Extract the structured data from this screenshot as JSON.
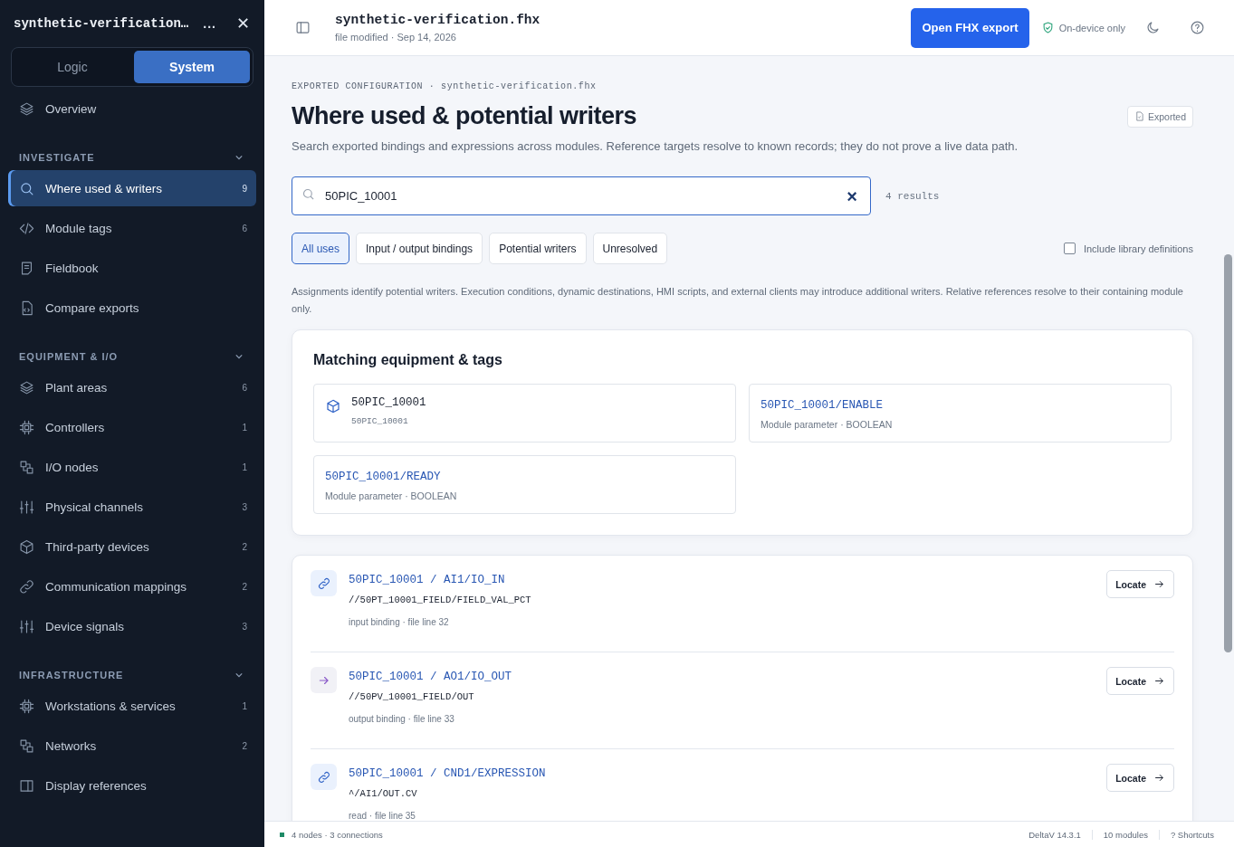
{
  "sidebar": {
    "file_title": "synthetic-verification…",
    "more": "...",
    "close": "✕",
    "modes": [
      {
        "label": "Logic",
        "selected": false
      },
      {
        "label": "System",
        "selected": true
      }
    ],
    "top_items": [
      {
        "label": "Overview",
        "selected": false
      }
    ],
    "sections": [
      {
        "title": "INVESTIGATE",
        "expanded": true,
        "items": [
          {
            "label": "Where used & writers",
            "count": "9",
            "selected": true
          },
          {
            "label": "Module tags",
            "count": "6",
            "selected": false
          },
          {
            "label": "Fieldbook",
            "selected": false
          },
          {
            "label": "Compare exports",
            "selected": false
          }
        ]
      },
      {
        "title": "EQUIPMENT & I/O",
        "expanded": true,
        "items": [
          {
            "label": "Plant areas",
            "count": "6",
            "selected": false
          },
          {
            "label": "Controllers",
            "count": "1",
            "selected": false
          },
          {
            "label": "I/O nodes",
            "count": "1",
            "selected": false
          },
          {
            "label": "Physical channels",
            "count": "3",
            "selected": false
          },
          {
            "label": "Third-party devices",
            "count": "2",
            "selected": false
          },
          {
            "label": "Communication mappings",
            "count": "2",
            "selected": false
          },
          {
            "label": "Device signals",
            "count": "3",
            "selected": false
          }
        ]
      },
      {
        "title": "INFRASTRUCTURE",
        "expanded": true,
        "items": [
          {
            "label": "Workstations & services",
            "count": "1",
            "selected": false
          },
          {
            "label": "Networks",
            "count": "2",
            "selected": false
          },
          {
            "label": "Display references",
            "selected": false
          }
        ]
      }
    ]
  },
  "header": {
    "title": "synthetic-verification.fhx",
    "subtitle": "file modified · Sep 14, 2026",
    "primary_button": "Open FHX export",
    "privacy": "On-device only"
  },
  "page": {
    "eyebrow": "EXPORTED CONFIGURATION · synthetic-verification.fhx",
    "title": "Where used & potential writers",
    "badge": "Exported",
    "description": "Search exported bindings and expressions across modules. Reference targets resolve to known records; they do not prove a live data path.",
    "search": {
      "value": "50PIC_10001",
      "clear": "×",
      "result_count": "4 results"
    },
    "filters": [
      {
        "label": "All uses",
        "selected": true
      },
      {
        "label": "Input / output bindings",
        "selected": false
      },
      {
        "label": "Potential writers",
        "selected": false
      },
      {
        "label": "Unresolved",
        "selected": false
      }
    ],
    "include_library": {
      "label": "Include library definitions",
      "checked": false
    },
    "notice": "Assignments identify potential writers. Execution conditions, dynamic destinations, HMI scripts, and external clients may introduce additional writers. Relative references resolve to their containing module only.",
    "matches": {
      "title": "Matching equipment & tags",
      "items": [
        {
          "kind": "module",
          "name": "50PIC_10001",
          "detail": "50PIC_10001"
        },
        {
          "kind": "parameter",
          "name": "50PIC_10001/ENABLE",
          "detail": "Module parameter · BOOLEAN"
        },
        {
          "kind": "parameter",
          "name": "50PIC_10001/READY",
          "detail": "Module parameter · BOOLEAN"
        }
      ]
    },
    "results": [
      {
        "kind": "input",
        "path": "50PIC_10001 / AI1/IO_IN",
        "reference": "//50PT_10001_FIELD/FIELD_VAL_PCT",
        "meta": "input binding · file line 32",
        "action": "Locate"
      },
      {
        "kind": "output",
        "path": "50PIC_10001 / AO1/IO_OUT",
        "reference": "//50PV_10001_FIELD/OUT",
        "meta": "output binding · file line 33",
        "action": "Locate"
      },
      {
        "kind": "read",
        "path": "50PIC_10001 / CND1/EXPRESSION",
        "reference": "^/AI1/OUT.CV",
        "meta": "read · file line 35",
        "action": "Locate"
      }
    ]
  },
  "status_bar": {
    "summary": "4 nodes · 3 connections",
    "version": "DeltaV 14.3.1",
    "modules": "10 modules",
    "shortcuts": "? Shortcuts"
  }
}
